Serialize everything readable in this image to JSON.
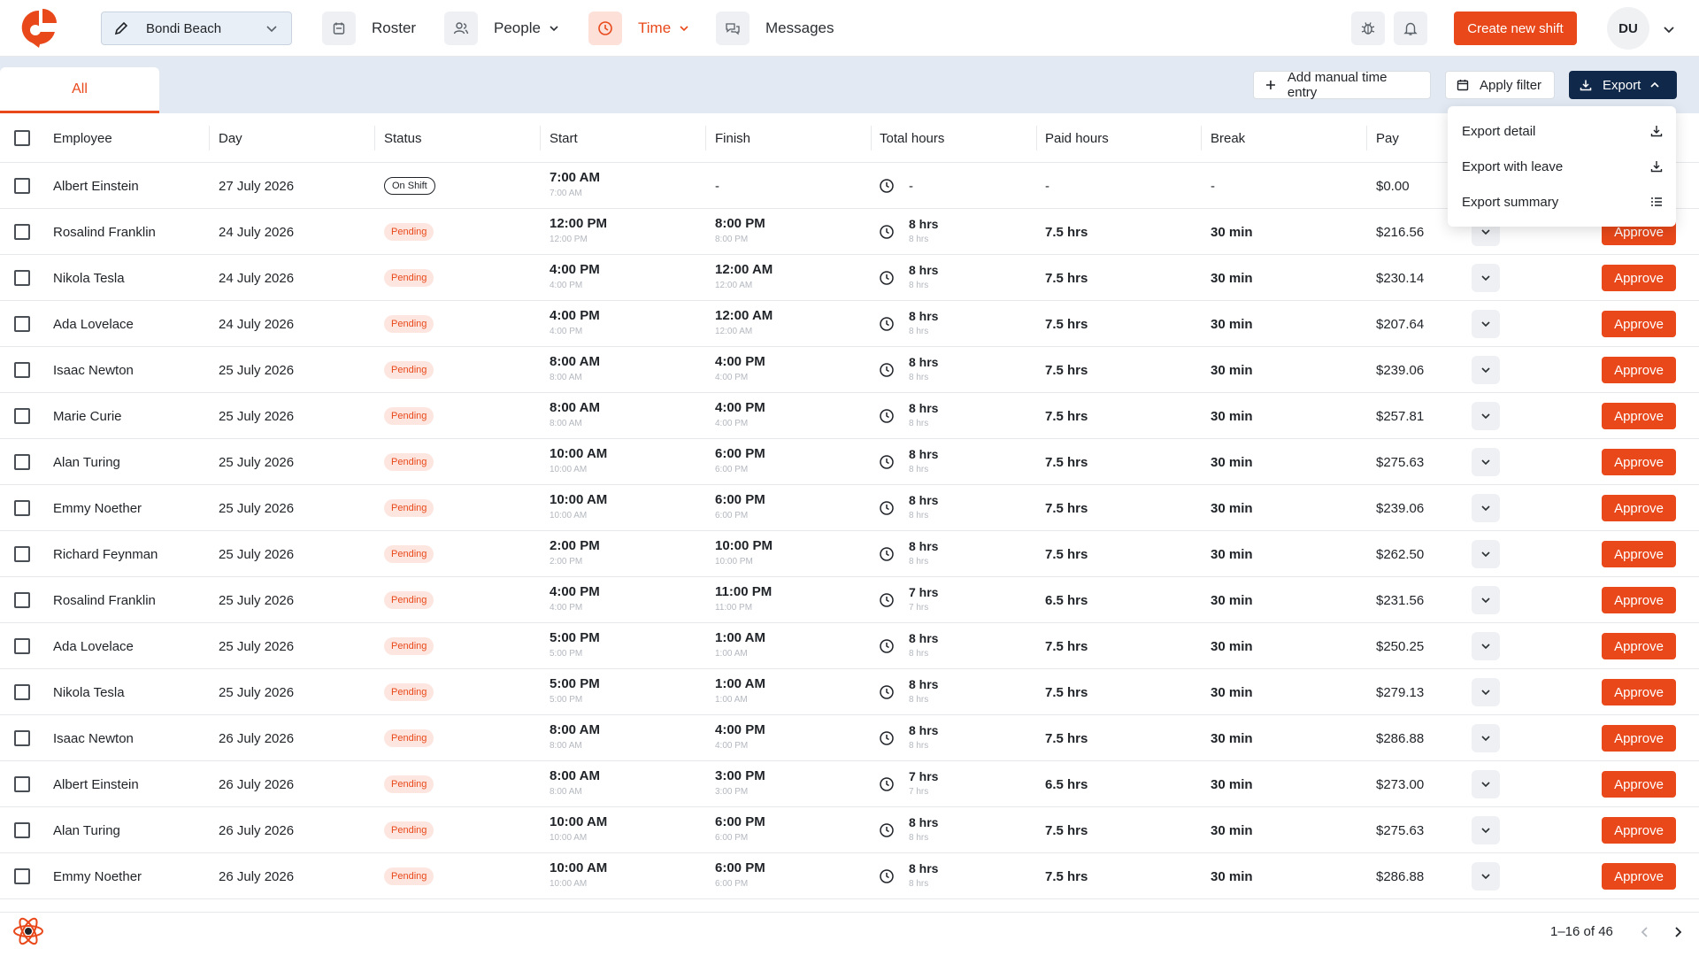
{
  "nav": {
    "location": "Bondi Beach",
    "roster": "Roster",
    "people": "People",
    "time": "Time",
    "messages": "Messages",
    "create_shift": "Create new shift",
    "avatar_initials": "DU"
  },
  "toolbar": {
    "tab_all": "All",
    "add_manual": "Add manual time entry",
    "apply_filter": "Apply filter",
    "export": "Export"
  },
  "export_menu": {
    "items": [
      "Export detail",
      "Export with leave",
      "Export summary"
    ]
  },
  "columns": [
    "Employee",
    "Day",
    "Status",
    "Start",
    "Finish",
    "Total hours",
    "Paid hours",
    "Break",
    "Pay"
  ],
  "rows": [
    {
      "employee": "Albert Einstein",
      "day": "27 July 2026",
      "status": "On Shift",
      "start": "7:00 AM",
      "start_sub": "7:00 AM",
      "finish": "-",
      "finish_sub": "",
      "total": "-",
      "total_sub": "",
      "paid": "-",
      "break": "-",
      "pay": "$0.00",
      "approve": ""
    },
    {
      "employee": "Rosalind Franklin",
      "day": "24 July 2026",
      "status": "Pending",
      "start": "12:00 PM",
      "start_sub": "12:00 PM",
      "finish": "8:00 PM",
      "finish_sub": "8:00 PM",
      "total": "8 hrs",
      "total_sub": "8 hrs",
      "paid": "7.5 hrs",
      "break": "30 min",
      "pay": "$216.56",
      "approve": "Approve"
    },
    {
      "employee": "Nikola Tesla",
      "day": "24 July 2026",
      "status": "Pending",
      "start": "4:00 PM",
      "start_sub": "4:00 PM",
      "finish": "12:00 AM",
      "finish_sub": "12:00 AM",
      "total": "8 hrs",
      "total_sub": "8 hrs",
      "paid": "7.5 hrs",
      "break": "30 min",
      "pay": "$230.14",
      "approve": "Approve"
    },
    {
      "employee": "Ada Lovelace",
      "day": "24 July 2026",
      "status": "Pending",
      "start": "4:00 PM",
      "start_sub": "4:00 PM",
      "finish": "12:00 AM",
      "finish_sub": "12:00 AM",
      "total": "8 hrs",
      "total_sub": "8 hrs",
      "paid": "7.5 hrs",
      "break": "30 min",
      "pay": "$207.64",
      "approve": "Approve"
    },
    {
      "employee": "Isaac Newton",
      "day": "25 July 2026",
      "status": "Pending",
      "start": "8:00 AM",
      "start_sub": "8:00 AM",
      "finish": "4:00 PM",
      "finish_sub": "4:00 PM",
      "total": "8 hrs",
      "total_sub": "8 hrs",
      "paid": "7.5 hrs",
      "break": "30 min",
      "pay": "$239.06",
      "approve": "Approve"
    },
    {
      "employee": "Marie Curie",
      "day": "25 July 2026",
      "status": "Pending",
      "start": "8:00 AM",
      "start_sub": "8:00 AM",
      "finish": "4:00 PM",
      "finish_sub": "4:00 PM",
      "total": "8 hrs",
      "total_sub": "8 hrs",
      "paid": "7.5 hrs",
      "break": "30 min",
      "pay": "$257.81",
      "approve": "Approve"
    },
    {
      "employee": "Alan Turing",
      "day": "25 July 2026",
      "status": "Pending",
      "start": "10:00 AM",
      "start_sub": "10:00 AM",
      "finish": "6:00 PM",
      "finish_sub": "6:00 PM",
      "total": "8 hrs",
      "total_sub": "8 hrs",
      "paid": "7.5 hrs",
      "break": "30 min",
      "pay": "$275.63",
      "approve": "Approve"
    },
    {
      "employee": "Emmy Noether",
      "day": "25 July 2026",
      "status": "Pending",
      "start": "10:00 AM",
      "start_sub": "10:00 AM",
      "finish": "6:00 PM",
      "finish_sub": "6:00 PM",
      "total": "8 hrs",
      "total_sub": "8 hrs",
      "paid": "7.5 hrs",
      "break": "30 min",
      "pay": "$239.06",
      "approve": "Approve"
    },
    {
      "employee": "Richard Feynman",
      "day": "25 July 2026",
      "status": "Pending",
      "start": "2:00 PM",
      "start_sub": "2:00 PM",
      "finish": "10:00 PM",
      "finish_sub": "10:00 PM",
      "total": "8 hrs",
      "total_sub": "8 hrs",
      "paid": "7.5 hrs",
      "break": "30 min",
      "pay": "$262.50",
      "approve": "Approve"
    },
    {
      "employee": "Rosalind Franklin",
      "day": "25 July 2026",
      "status": "Pending",
      "start": "4:00 PM",
      "start_sub": "4:00 PM",
      "finish": "11:00 PM",
      "finish_sub": "11:00 PM",
      "total": "7 hrs",
      "total_sub": "7 hrs",
      "paid": "6.5 hrs",
      "break": "30 min",
      "pay": "$231.56",
      "approve": "Approve"
    },
    {
      "employee": "Ada Lovelace",
      "day": "25 July 2026",
      "status": "Pending",
      "start": "5:00 PM",
      "start_sub": "5:00 PM",
      "finish": "1:00 AM",
      "finish_sub": "1:00 AM",
      "total": "8 hrs",
      "total_sub": "8 hrs",
      "paid": "7.5 hrs",
      "break": "30 min",
      "pay": "$250.25",
      "approve": "Approve"
    },
    {
      "employee": "Nikola Tesla",
      "day": "25 July 2026",
      "status": "Pending",
      "start": "5:00 PM",
      "start_sub": "5:00 PM",
      "finish": "1:00 AM",
      "finish_sub": "1:00 AM",
      "total": "8 hrs",
      "total_sub": "8 hrs",
      "paid": "7.5 hrs",
      "break": "30 min",
      "pay": "$279.13",
      "approve": "Approve"
    },
    {
      "employee": "Isaac Newton",
      "day": "26 July 2026",
      "status": "Pending",
      "start": "8:00 AM",
      "start_sub": "8:00 AM",
      "finish": "4:00 PM",
      "finish_sub": "4:00 PM",
      "total": "8 hrs",
      "total_sub": "8 hrs",
      "paid": "7.5 hrs",
      "break": "30 min",
      "pay": "$286.88",
      "approve": "Approve"
    },
    {
      "employee": "Albert Einstein",
      "day": "26 July 2026",
      "status": "Pending",
      "start": "8:00 AM",
      "start_sub": "8:00 AM",
      "finish": "3:00 PM",
      "finish_sub": "3:00 PM",
      "total": "7 hrs",
      "total_sub": "7 hrs",
      "paid": "6.5 hrs",
      "break": "30 min",
      "pay": "$273.00",
      "approve": "Approve"
    },
    {
      "employee": "Alan Turing",
      "day": "26 July 2026",
      "status": "Pending",
      "start": "10:00 AM",
      "start_sub": "10:00 AM",
      "finish": "6:00 PM",
      "finish_sub": "6:00 PM",
      "total": "8 hrs",
      "total_sub": "8 hrs",
      "paid": "7.5 hrs",
      "break": "30 min",
      "pay": "$275.63",
      "approve": "Approve"
    },
    {
      "employee": "Emmy Noether",
      "day": "26 July 2026",
      "status": "Pending",
      "start": "10:00 AM",
      "start_sub": "10:00 AM",
      "finish": "6:00 PM",
      "finish_sub": "6:00 PM",
      "total": "8 hrs",
      "total_sub": "8 hrs",
      "paid": "7.5 hrs",
      "break": "30 min",
      "pay": "$286.88",
      "approve": "Approve"
    }
  ],
  "pagination": {
    "text": "1–16 of 46"
  },
  "colors": {
    "accent": "#e8481a",
    "navy": "#10284a",
    "toolbar_bg": "#e3e9f2"
  }
}
